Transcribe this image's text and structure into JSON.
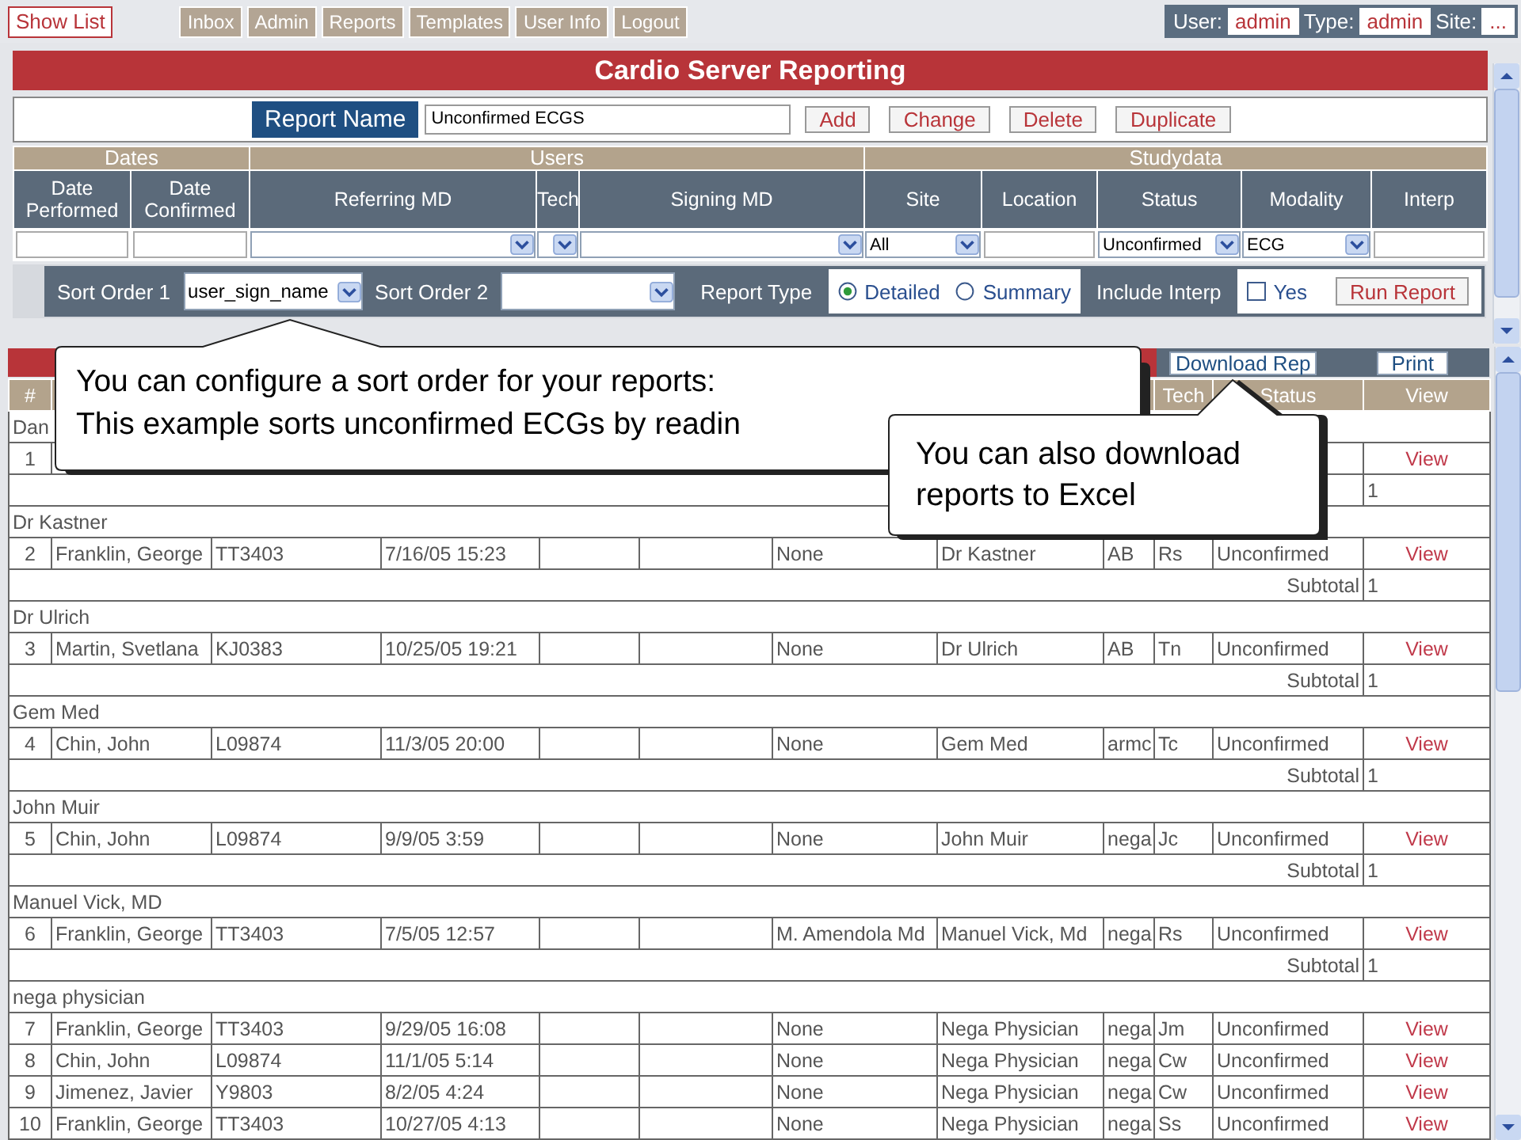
{
  "top_bar": {
    "show_list": "Show List",
    "nav": [
      "Inbox",
      "Admin",
      "Reports",
      "Templates",
      "User Info",
      "Logout"
    ],
    "session": [
      {
        "label": "User:",
        "value": "admin"
      },
      {
        "label": "Type:",
        "value": "admin"
      },
      {
        "label": "Site:",
        "value": "..."
      }
    ]
  },
  "title": "Cardio Server Reporting",
  "report": {
    "label": "Report Name",
    "name": "Unconfirmed ECGS",
    "buttons": [
      "Add",
      "Change",
      "Delete",
      "Duplicate"
    ]
  },
  "filter_groups": [
    {
      "label": "Dates",
      "columns": [
        {
          "label": "Date Performed",
          "kind": "text"
        },
        {
          "label": "Date Confirmed",
          "kind": "text"
        }
      ]
    },
    {
      "label": "Users",
      "columns": [
        {
          "label": "Referring MD",
          "kind": "select"
        },
        {
          "label": "Tech",
          "kind": "select"
        },
        {
          "label": "Signing MD",
          "kind": "select"
        }
      ]
    },
    {
      "label": "Studydata",
      "columns": [
        {
          "label": "Site",
          "kind": "select",
          "value": "All"
        },
        {
          "label": "Location",
          "kind": "text"
        },
        {
          "label": "Status",
          "kind": "select",
          "value": "Unconfirmed"
        },
        {
          "label": "Modality",
          "kind": "select",
          "value": "ECG"
        },
        {
          "label": "Interp",
          "kind": "text"
        }
      ]
    }
  ],
  "sort": {
    "sort1_label": "Sort Order 1",
    "sort1": "user_sign_name",
    "sort2_label": "Sort Order 2",
    "report_type_label": "Report Type",
    "report_types": [
      {
        "label": "Detailed",
        "selected": true
      },
      {
        "label": "Summary",
        "selected": false
      }
    ],
    "include_interp_label": "Include Interp",
    "include_interp": {
      "label": "Yes",
      "checked": false
    },
    "run": "Run Report"
  },
  "results": {
    "buttons": [
      "Download Rep",
      "Print"
    ],
    "header": {
      "num": "#",
      "tech": "Tech",
      "status": "Status",
      "action": "View"
    },
    "groups": [
      {
        "name": "Dan",
        "rows": [
          {
            "num": "1",
            "action": "View"
          }
        ],
        "subtotal": "1"
      },
      {
        "name": "Dr Kastner",
        "rows": [
          {
            "num": "2",
            "patient": "Franklin, George",
            "patient_id": "TT3403",
            "date": "7/16/05 15:23",
            "referring": "None",
            "signing": "Dr Kastner",
            "site": "AB",
            "tech": "Rs",
            "status": "Unconfirmed",
            "action": "View"
          }
        ],
        "subtotal_label": "Subtotal",
        "subtotal": "1"
      },
      {
        "name": "Dr Ulrich",
        "rows": [
          {
            "num": "3",
            "patient": "Martin, Svetlana",
            "patient_id": "KJ0383",
            "date": "10/25/05 19:21",
            "referring": "None",
            "signing": "Dr Ulrich",
            "site": "AB",
            "tech": "Tn",
            "status": "Unconfirmed",
            "action": "View"
          }
        ],
        "subtotal_label": "Subtotal",
        "subtotal": "1"
      },
      {
        "name": "Gem Med",
        "rows": [
          {
            "num": "4",
            "patient": "Chin, John",
            "patient_id": "L09874",
            "date": "11/3/05 20:00",
            "referring": "None",
            "signing": "Gem Med",
            "site": "armc",
            "tech": "Tc",
            "status": "Unconfirmed",
            "action": "View"
          }
        ],
        "subtotal_label": "Subtotal",
        "subtotal": "1"
      },
      {
        "name": "John Muir",
        "rows": [
          {
            "num": "5",
            "patient": "Chin, John",
            "patient_id": "L09874",
            "date": "9/9/05 3:59",
            "referring": "None",
            "signing": "John Muir",
            "site": "nega",
            "tech": "Jc",
            "status": "Unconfirmed",
            "action": "View"
          }
        ],
        "subtotal_label": "Subtotal",
        "subtotal": "1"
      },
      {
        "name": "Manuel Vick, MD",
        "rows": [
          {
            "num": "6",
            "patient": "Franklin, George",
            "patient_id": "TT3403",
            "date": "7/5/05 12:57",
            "referring": "M. Amendola Md",
            "signing": "Manuel Vick, Md",
            "site": "nega",
            "tech": "Rs",
            "status": "Unconfirmed",
            "action": "View"
          }
        ],
        "subtotal_label": "Subtotal",
        "subtotal": "1"
      },
      {
        "name": "nega physician",
        "rows": [
          {
            "num": "7",
            "patient": "Franklin, George",
            "patient_id": "TT3403",
            "date": "9/29/05 16:08",
            "referring": "None",
            "signing": "Nega Physician",
            "site": "nega",
            "tech": "Jm",
            "status": "Unconfirmed",
            "action": "View"
          },
          {
            "num": "8",
            "patient": "Chin, John",
            "patient_id": "L09874",
            "date": "11/1/05 5:14",
            "referring": "None",
            "signing": "Nega Physician",
            "site": "nega",
            "tech": "Cw",
            "status": "Unconfirmed",
            "action": "View"
          },
          {
            "num": "9",
            "patient": "Jimenez, Javier",
            "patient_id": "Y9803",
            "date": "8/2/05 4:24",
            "referring": "None",
            "signing": "Nega Physician",
            "site": "nega",
            "tech": "Cw",
            "status": "Unconfirmed",
            "action": "View"
          },
          {
            "num": "10",
            "patient": "Franklin, George",
            "patient_id": "TT3403",
            "date": "10/27/05 4:13",
            "referring": "None",
            "signing": "Nega Physician",
            "site": "nega",
            "tech": "Ss",
            "status": "Unconfirmed",
            "action": "View"
          }
        ]
      }
    ]
  },
  "callouts": [
    {
      "text": "You can configure a sort order for your reports:\nThis example sorts unconfirmed ECGs by readin"
    },
    {
      "text": "You can also download\nreports to Excel"
    }
  ]
}
